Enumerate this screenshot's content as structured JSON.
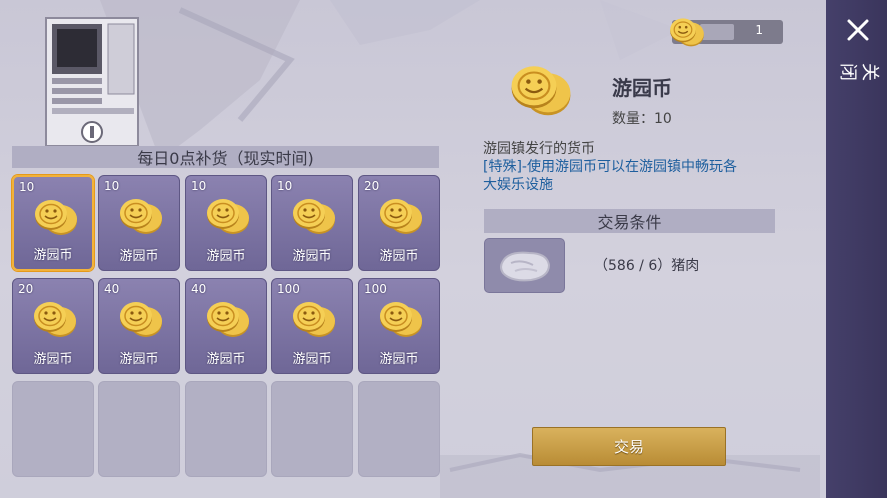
{
  "shop": {
    "section_title": "每日0点补货（现实时间)",
    "items": [
      {
        "qty": "10",
        "name": "游园币",
        "selected": true
      },
      {
        "qty": "10",
        "name": "游园币"
      },
      {
        "qty": "10",
        "name": "游园币"
      },
      {
        "qty": "10",
        "name": "游园币"
      },
      {
        "qty": "20",
        "name": "游园币"
      },
      {
        "qty": "20",
        "name": "游园币"
      },
      {
        "qty": "40",
        "name": "游园币"
      },
      {
        "qty": "40",
        "name": "游园币"
      },
      {
        "qty": "100",
        "name": "游园币"
      },
      {
        "qty": "100",
        "name": "游园币"
      }
    ]
  },
  "currency": {
    "count": "1",
    "icon": "coin-icon"
  },
  "detail": {
    "title": "游园币",
    "quantity": "数量：10",
    "description": "游园镇发行的货币",
    "special_line1": "[特殊]-使用游园币可以在游园镇中畅玩各",
    "special_line2": "大娱乐设施",
    "trade_header": "交易条件",
    "material_text": "（586 / 6）猪肉",
    "material_icon": "pork-icon"
  },
  "actions": {
    "trade_label": "交易",
    "close_label": "关闭"
  },
  "colors": {
    "accent_gold": "#c99a3e",
    "slot_purple": "#7b73a4",
    "link_blue": "#1e5f9e",
    "sidebar": "#3f3a63"
  }
}
